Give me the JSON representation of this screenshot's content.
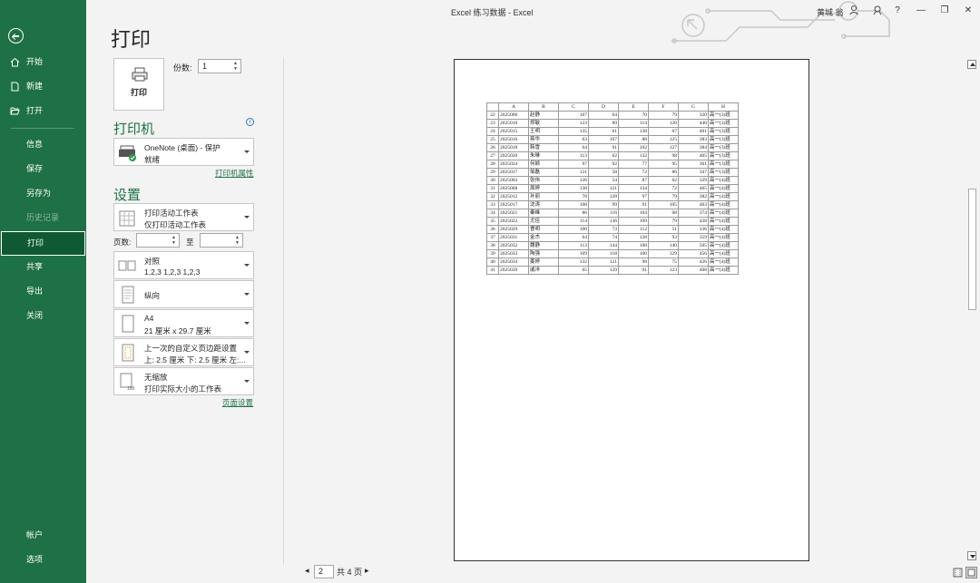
{
  "window": {
    "title": "Excel 练习数据  -  Excel",
    "user": "黄城 翁",
    "controls": [
      "?",
      "—",
      "❐",
      "✕"
    ]
  },
  "sidebar": {
    "items": [
      {
        "label": "开始",
        "icon": "home-icon"
      },
      {
        "label": "新建",
        "icon": "new-doc-icon"
      },
      {
        "label": "打开",
        "icon": "folder-open-icon"
      },
      {
        "label": "信息"
      },
      {
        "label": "保存"
      },
      {
        "label": "另存为"
      },
      {
        "label": "历史记录"
      },
      {
        "label": "打印"
      },
      {
        "label": "共享"
      },
      {
        "label": "导出"
      },
      {
        "label": "关闭"
      }
    ],
    "bottom": [
      {
        "label": "帐户"
      },
      {
        "label": "选项"
      }
    ]
  },
  "print": {
    "heading": "打印",
    "button_label": "打印",
    "copies_label": "份数:",
    "copies_value": "1",
    "printer_heading": "打印机",
    "printer_name": "OneNote (桌面) - 保护",
    "printer_status": "就绪",
    "printer_props_link": "打印机属性",
    "settings_heading": "设置",
    "settings": [
      {
        "l1": "打印活动工作表",
        "l2": "仅打印活动工作表"
      },
      {
        "l1": "对照",
        "l2": "1,2,3    1,2,3    1,2,3"
      },
      {
        "l1": "纵向"
      },
      {
        "l1": "A4",
        "l2": "21 厘米 x 29.7 厘米"
      },
      {
        "l1": "上一次的自定义页边距设置",
        "l2": "上: 2.5 厘米 下: 2.5 厘米 左:..."
      },
      {
        "l1": "无缩放",
        "l2": "打印实际大小的工作表"
      }
    ],
    "pages_label": "页数:",
    "to_label": "至",
    "page_setup_link": "页面设置"
  },
  "preview": {
    "current_page": "2",
    "total_pages_label": "共 4 页",
    "columns": [
      "",
      "A",
      "B",
      "C",
      "D",
      "E",
      "F",
      "G",
      "H"
    ],
    "rows": [
      [
        "22",
        "2025006",
        "赵静",
        "107",
        "64",
        "70",
        "79",
        "320",
        "高一(3)班"
      ],
      [
        "23",
        "2025010",
        "郑敏",
        "123",
        "89",
        "114",
        "120",
        "446",
        "高一(3)班"
      ],
      [
        "24",
        "2025015",
        "王明",
        "135",
        "61",
        "138",
        "67",
        "401",
        "高一(3)班"
      ],
      [
        "25",
        "2025016",
        "蒋华",
        "63",
        "107",
        "88",
        "125",
        "383",
        "高一(3)班"
      ],
      [
        "26",
        "2025018",
        "韩雪",
        "64",
        "91",
        "102",
        "127",
        "384",
        "高一(3)班"
      ],
      [
        "27",
        "2025020",
        "朱琳",
        "113",
        "62",
        "132",
        "98",
        "405",
        "高一(3)班"
      ],
      [
        "28",
        "2025024",
        "何颖",
        "97",
        "92",
        "77",
        "95",
        "361",
        "高一(3)班"
      ],
      [
        "29",
        "2025037",
        "邹磊",
        "131",
        "58",
        "72",
        "86",
        "347",
        "高一(3)班"
      ],
      [
        "30",
        "2025003",
        "张伟",
        "126",
        "54",
        "87",
        "62",
        "329",
        "高一(4)班"
      ],
      [
        "31",
        "2025008",
        "周婷",
        "138",
        "121",
        "134",
        "72",
        "465",
        "高一(4)班"
      ],
      [
        "32",
        "2025012",
        "孙丽",
        "78",
        "128",
        "97",
        "79",
        "382",
        "高一(4)班"
      ],
      [
        "33",
        "2025017",
        "沈涛",
        "108",
        "99",
        "91",
        "105",
        "403",
        "高一(4)班"
      ],
      [
        "34",
        "2025021",
        "秦峰",
        "86",
        "116",
        "104",
        "68",
        "374",
        "高一(4)班"
      ],
      [
        "35",
        "2025022",
        "尤佳",
        "114",
        "136",
        "109",
        "79",
        "438",
        "高一(4)班"
      ],
      [
        "36",
        "2025029",
        "曹明",
        "100",
        "73",
        "112",
        "51",
        "336",
        "高一(4)班"
      ],
      [
        "37",
        "2025031",
        "金杰",
        "64",
        "74",
        "128",
        "93",
        "359",
        "高一(4)班"
      ],
      [
        "38",
        "2025032",
        "魏静",
        "113",
        "144",
        "108",
        "140",
        "505",
        "高一(4)班"
      ],
      [
        "39",
        "2025033",
        "陶强",
        "109",
        "118",
        "100",
        "129",
        "456",
        "高一(4)班"
      ],
      [
        "40",
        "2025034",
        "姜婷",
        "132",
        "121",
        "98",
        "75",
        "426",
        "高一(4)班"
      ],
      [
        "41",
        "2025039",
        "戚洋",
        "65",
        "129",
        "91",
        "123",
        "408",
        "高一(4)班"
      ]
    ]
  }
}
